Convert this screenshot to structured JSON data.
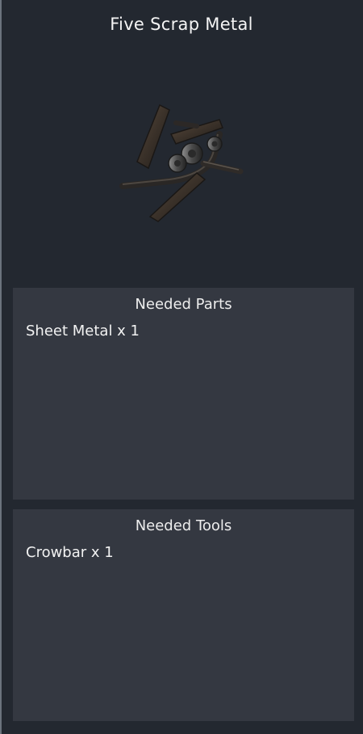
{
  "item": {
    "title": "Five Scrap Metal",
    "icon": "scrap-metal-pile"
  },
  "needed_parts": {
    "header": "Needed Parts",
    "items": [
      "Sheet Metal x 1"
    ]
  },
  "needed_tools": {
    "header": "Needed Tools",
    "items": [
      "Crowbar x 1"
    ]
  },
  "colors": {
    "background": "#232830",
    "panel": "#343841",
    "text": "#f0f0f0"
  }
}
